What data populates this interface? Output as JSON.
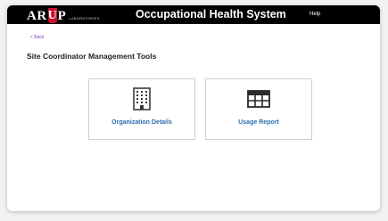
{
  "header": {
    "logo_text": "ARUP",
    "logo_sub": "LABORATORIES",
    "app_title": "Occupational Health System",
    "help_label": "Help"
  },
  "nav": {
    "back_label": "< Back"
  },
  "main": {
    "title": "Site Coordinator Management Tools",
    "cards": [
      {
        "label": "Organization Details",
        "icon": "building-icon"
      },
      {
        "label": "Usage Report",
        "icon": "table-icon"
      }
    ]
  },
  "colors": {
    "topbar": "#000000",
    "brand_red": "#c8102e",
    "link_blue": "#2a6fb0",
    "back_purple": "#7b3fb5"
  }
}
